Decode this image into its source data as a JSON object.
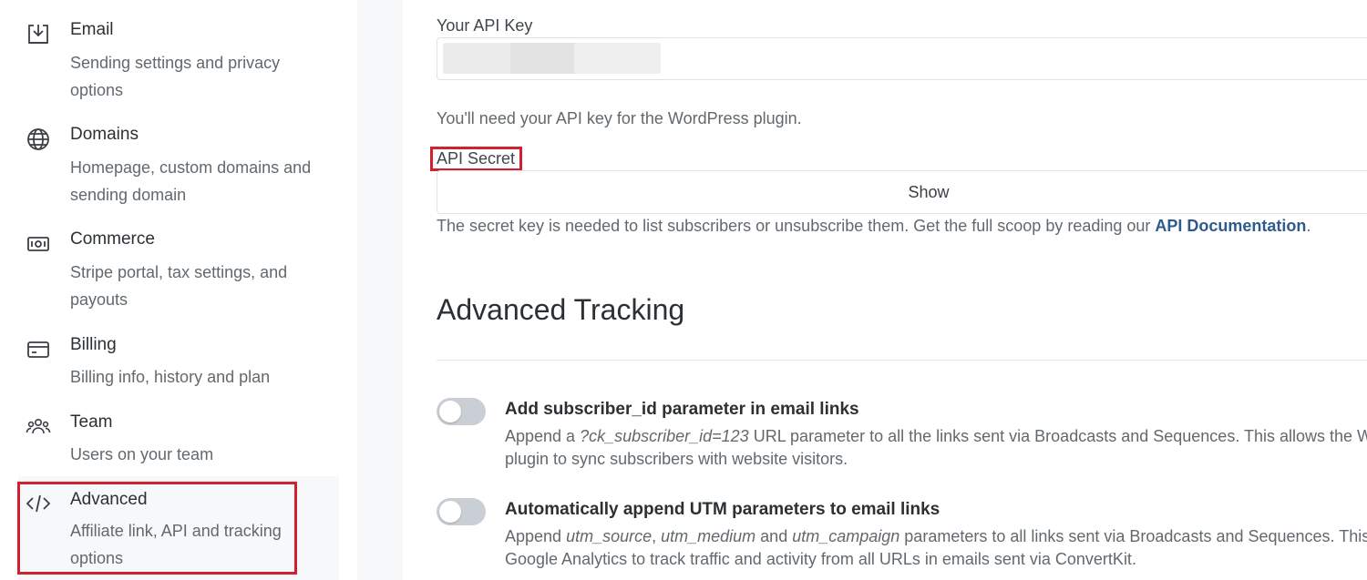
{
  "sidebar": {
    "items": [
      {
        "title": "Email",
        "desc": "Sending settings and privacy options",
        "icon": "inbox-download-icon"
      },
      {
        "title": "Domains",
        "desc": "Homepage, custom domains and sending domain",
        "icon": "globe-icon"
      },
      {
        "title": "Commerce",
        "desc": "Stripe portal, tax settings, and payouts",
        "icon": "cash-icon"
      },
      {
        "title": "Billing",
        "desc": "Billing info, history and plan",
        "icon": "credit-card-icon"
      },
      {
        "title": "Team",
        "desc": "Users on your team",
        "icon": "team-icon"
      },
      {
        "title": "Advanced",
        "desc": "Affiliate link, API and tracking options",
        "icon": "code-icon"
      }
    ]
  },
  "api": {
    "key_label": "Your API Key",
    "key_help": "You'll need your API key for the WordPress plugin.",
    "secret_label": "API Secret",
    "show_button": "Show",
    "secret_help": "The secret key is needed to list subscribers or unsubscribe them. Get the full scoop by reading our ",
    "doc_link": "API Documentation",
    "secret_help_end": "."
  },
  "tracking": {
    "heading": "Advanced Tracking",
    "options": [
      {
        "title": "Add subscriber_id parameter in email links",
        "line1_a": "Append a ",
        "line1_code": "?ck_subscriber_id=123",
        "line1_b": " URL parameter to all the links sent via Broadcasts and Sequences. This allows the Wo",
        "line2": "plugin to sync subscribers with website visitors.",
        "enabled": false
      },
      {
        "title": "Automatically append UTM parameters to email links",
        "line1_a": "Append ",
        "line1_c1": "utm_source",
        "line1_sep1": ", ",
        "line1_c2": "utm_medium",
        "line1_sep2": " and ",
        "line1_c3": "utm_campaign",
        "line1_b": " parameters to all links sent via Broadcasts and Sequences. This",
        "line2": "Google Analytics to track traffic and activity from all URLs in emails sent via ConvertKit.",
        "enabled": false
      }
    ]
  },
  "colors": {
    "accent_link": "#2f5a8e",
    "highlight_box": "#d2202f",
    "toggle_off": "#c9cfd4"
  }
}
